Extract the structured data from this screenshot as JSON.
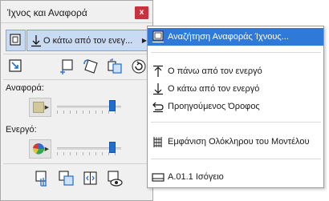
{
  "palette": {
    "title": "Ίχνος και Αναφορά",
    "close_glyph": "x",
    "combo_value": "Ο κάτω από τον ενεγ...",
    "reference_label": "Αναφορά:",
    "active_label": "Ενεργό:",
    "reference_slider_level": 0.9,
    "active_slider_level": 0.9,
    "colors": {
      "reference_swatch": "#d2c99a",
      "active_swatch": "multicolor",
      "accent": "#1e6fd1"
    },
    "icons": {
      "toggle": "trace-toggle-icon",
      "row1": [
        "move-trace-icon",
        "drag-icon",
        "rotate-icon",
        "mirror-icon",
        "reset-icon"
      ],
      "row2": [
        "hand-icon",
        "compare-icon",
        "switch-icon",
        "eye-icon"
      ]
    }
  },
  "menu": {
    "items": [
      {
        "label": "Αναζήτηση Αναφοράς Ίχνους...",
        "icon": "search-reference-icon",
        "selected": true
      },
      {
        "label": "Ο πάνω από τον ενεργό",
        "icon": "arrow-up-icon"
      },
      {
        "label": "Ο κάτω από τον ενεργό",
        "icon": "arrow-down-icon"
      },
      {
        "label": "Προηγούμενος Όροφος",
        "icon": "previous-story-icon"
      },
      {
        "label": "Εμφάνιση Ολόκληρου του Μοντέλου",
        "icon": "whole-model-icon"
      },
      {
        "label": "A.01.1 Ισόγειο",
        "icon": "story-icon"
      }
    ]
  }
}
